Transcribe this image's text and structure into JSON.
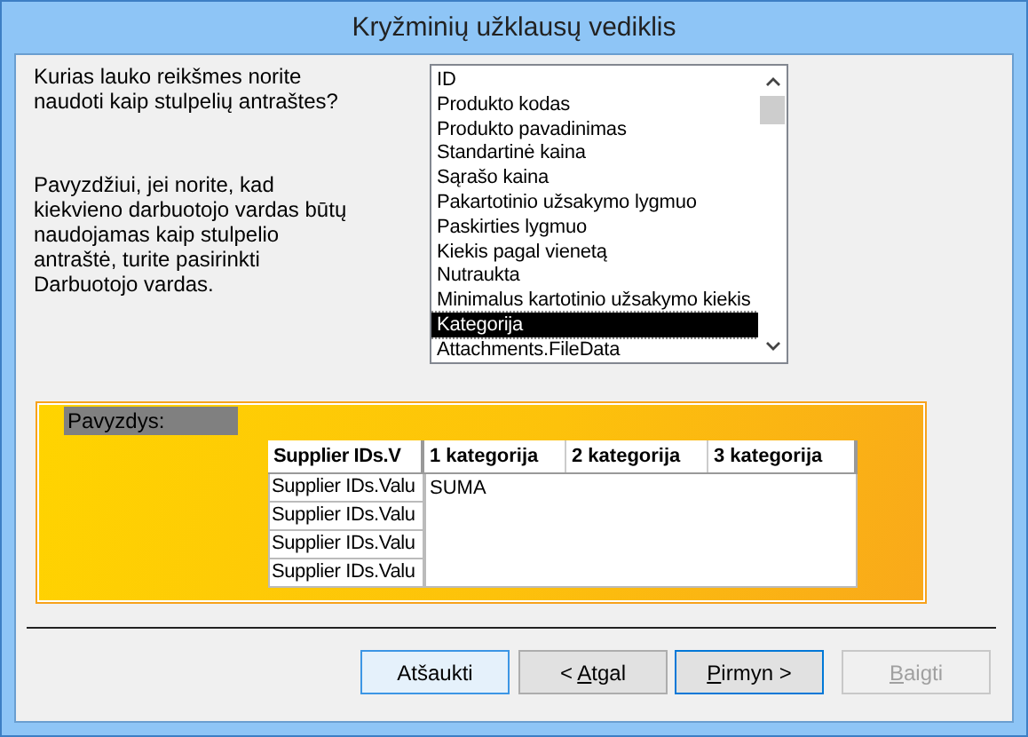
{
  "window": {
    "title": "Kryžminių užklausų vediklis"
  },
  "prompt": "Kurias lauko reikšmes norite naudoti kaip stulpelių antraštes?",
  "hint": "Pavyzdžiui, jei norite, kad kiekvieno darbuotojo vardas būtų naudojamas kaip stulpelio antraštė, turite pasirinkti Darbuotojo vardas.",
  "fields": [
    {
      "label": "ID",
      "selected": false
    },
    {
      "label": "Produkto kodas",
      "selected": false
    },
    {
      "label": "Produkto pavadinimas",
      "selected": false
    },
    {
      "label": "Standartinė kaina",
      "selected": false
    },
    {
      "label": "Sąrašo kaina",
      "selected": false
    },
    {
      "label": "Pakartotinio užsakymo lygmuo",
      "selected": false
    },
    {
      "label": "Paskirties lygmuo",
      "selected": false
    },
    {
      "label": "Kiekis pagal vienetą",
      "selected": false
    },
    {
      "label": "Nutraukta",
      "selected": false
    },
    {
      "label": "Minimalus kartotinio užsakymo kiekis",
      "selected": false
    },
    {
      "label": "Kategorija",
      "selected": true
    },
    {
      "label": "Attachments.FileData",
      "selected": false
    }
  ],
  "sample": {
    "label": "Pavyzdys:",
    "columns": [
      "Supplier IDs.V",
      "1 kategorija",
      "2 kategorija",
      "3 kategorija"
    ],
    "row_headers": [
      "Supplier IDs.Valu",
      "Supplier IDs.Valu",
      "Supplier IDs.Valu",
      "Supplier IDs.Valu"
    ],
    "value": "SUMA"
  },
  "buttons": [
    {
      "label": [
        {
          "text": "Atšaukti",
          "underline": false
        }
      ],
      "highlighted": true,
      "default": false,
      "disabled": false
    },
    {
      "label": [
        {
          "text": "< ",
          "underline": false
        },
        {
          "text": "A",
          "underline": true
        },
        {
          "text": "tgal",
          "underline": false
        }
      ],
      "highlighted": false,
      "default": false,
      "disabled": false
    },
    {
      "label": [
        {
          "text": "P",
          "underline": true
        },
        {
          "text": "irmyn >",
          "underline": false
        }
      ],
      "highlighted": false,
      "default": true,
      "disabled": false
    },
    {
      "label": [
        {
          "text": "B",
          "underline": true
        },
        {
          "text": "aigti",
          "underline": false
        }
      ],
      "highlighted": false,
      "default": false,
      "disabled": true
    }
  ]
}
